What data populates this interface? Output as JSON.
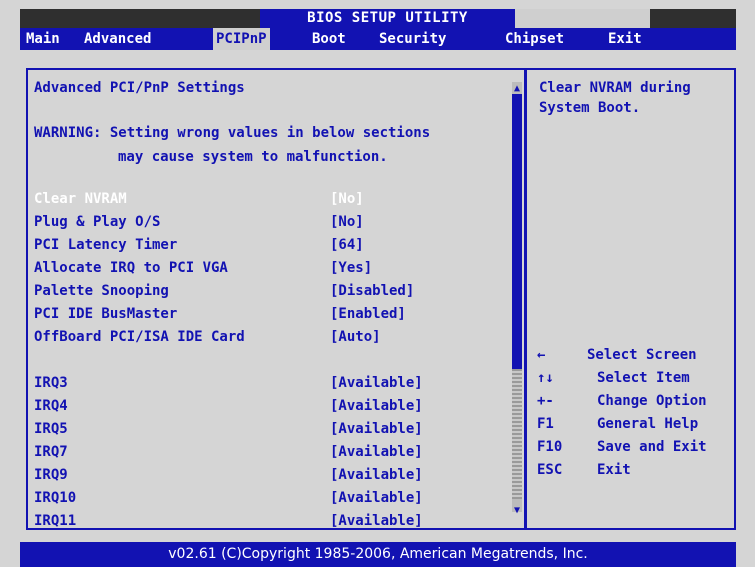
{
  "header": {
    "title": "BIOS SETUP UTILITY"
  },
  "menu": {
    "tabs": [
      {
        "label": "Main"
      },
      {
        "label": "Advanced"
      },
      {
        "label": "PCIPnP"
      },
      {
        "label": "Boot"
      },
      {
        "label": "Security"
      },
      {
        "label": "Chipset"
      },
      {
        "label": "Exit"
      }
    ],
    "active": "PCIPnP"
  },
  "main": {
    "section_title": "Advanced PCI/PnP Settings",
    "warning_line1": "WARNING: Setting wrong values in below sections",
    "warning_line2": "may cause system to malfunction.",
    "settings": [
      {
        "label": "Clear NVRAM",
        "value": "[No]"
      },
      {
        "label": "Plug & Play O/S",
        "value": "[No]"
      },
      {
        "label": "PCI Latency Timer",
        "value": "[64]"
      },
      {
        "label": "Allocate IRQ to PCI VGA",
        "value": "[Yes]"
      },
      {
        "label": "Palette Snooping",
        "value": "[Disabled]"
      },
      {
        "label": "PCI IDE BusMaster",
        "value": "[Enabled]"
      },
      {
        "label": "OffBoard PCI/ISA IDE Card",
        "value": "[Auto]"
      }
    ],
    "irqs": [
      {
        "label": "IRQ3",
        "value": "[Available]"
      },
      {
        "label": "IRQ4",
        "value": "[Available]"
      },
      {
        "label": "IRQ5",
        "value": "[Available]"
      },
      {
        "label": "IRQ7",
        "value": "[Available]"
      },
      {
        "label": "IRQ9",
        "value": "[Available]"
      },
      {
        "label": "IRQ10",
        "value": "[Available]"
      },
      {
        "label": "IRQ11",
        "value": "[Available]"
      }
    ]
  },
  "help": {
    "line1": "Clear NVRAM during",
    "line2": "System Boot.",
    "keys": [
      {
        "key": "←",
        "action": "Select Screen"
      },
      {
        "key": "↑↓",
        "action": "Select Item"
      },
      {
        "key": "+-",
        "action": "Change Option"
      },
      {
        "key": "F1",
        "action": "General Help"
      },
      {
        "key": "F10",
        "action": "Save and Exit"
      },
      {
        "key": "ESC",
        "action": "Exit"
      }
    ]
  },
  "footer": {
    "text": "v02.61 (C)Copyright 1985-2006, American Megatrends, Inc."
  },
  "colors": {
    "bios_blue": "#1212b2",
    "panel_gray": "#d5d5d5",
    "highlight_white": "#ffffff"
  }
}
